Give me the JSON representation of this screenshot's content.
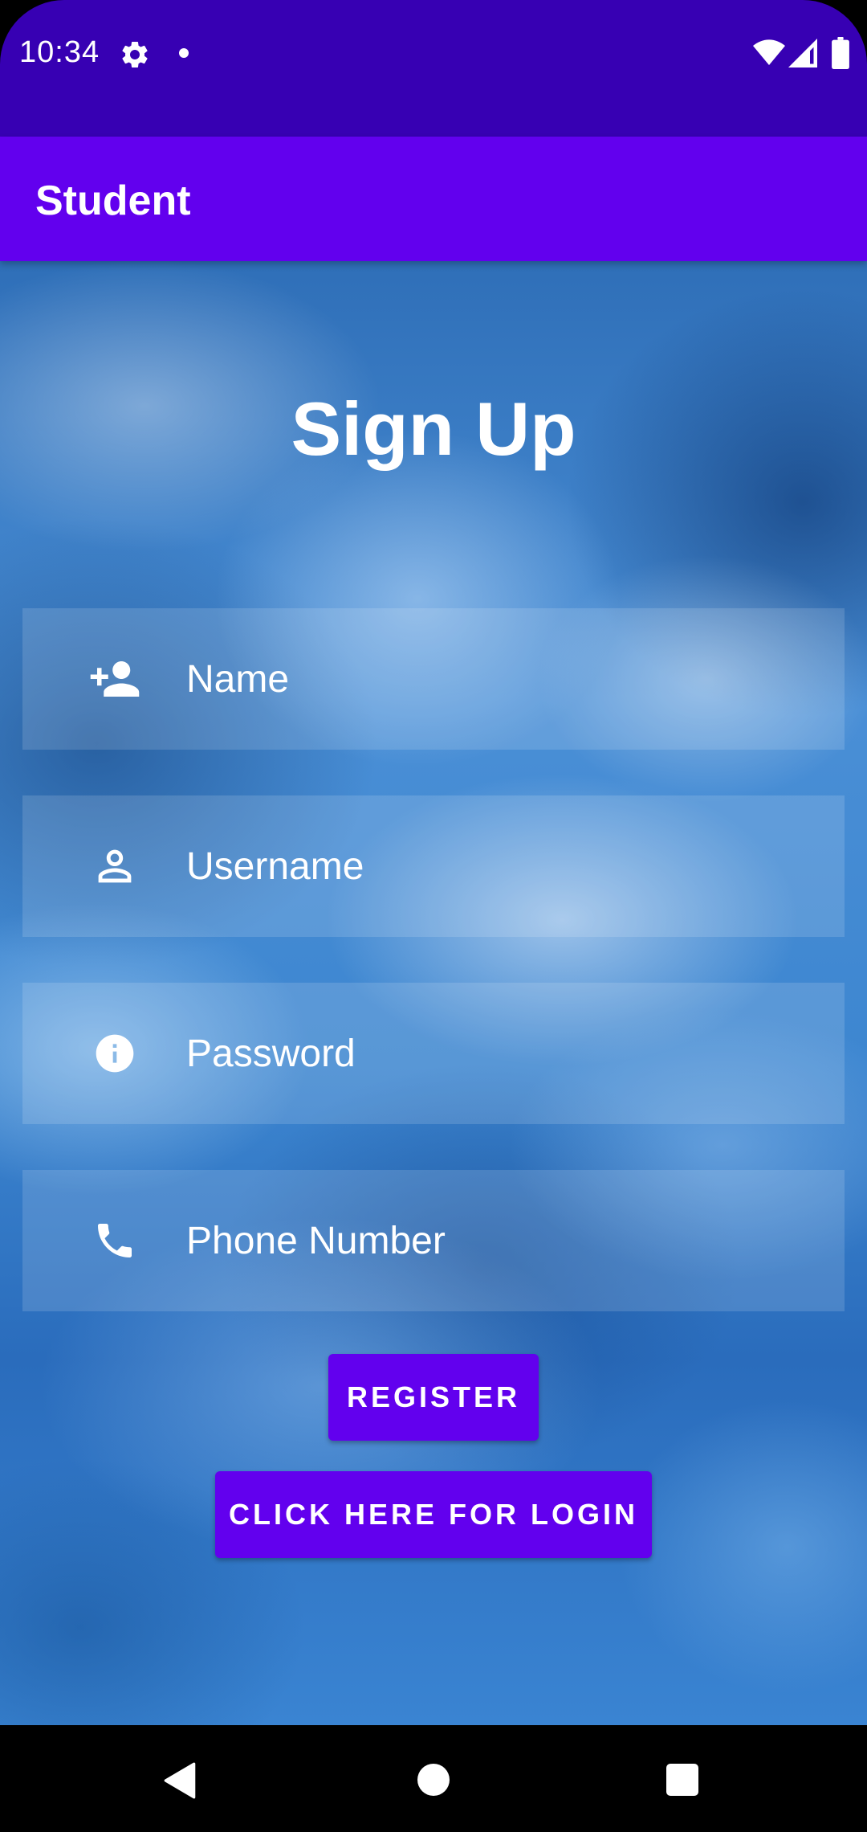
{
  "status_bar": {
    "time": "10:34",
    "icons": [
      "gear-icon",
      "notification-dot",
      "wifi-icon",
      "signal-icon",
      "battery-icon"
    ]
  },
  "app_bar": {
    "title": "Student"
  },
  "form": {
    "heading": "Sign Up",
    "fields": [
      {
        "icon": "person-add-icon",
        "placeholder": "Name",
        "value": ""
      },
      {
        "icon": "person-outline-icon",
        "placeholder": "Username",
        "value": ""
      },
      {
        "icon": "info-icon",
        "placeholder": "Password",
        "value": ""
      },
      {
        "icon": "phone-icon",
        "placeholder": "Phone Number",
        "value": ""
      }
    ],
    "register_label": "REGISTER",
    "login_label": "CLICK HERE FOR LOGIN"
  },
  "nav_bar": {
    "icons": [
      "back-icon",
      "home-icon",
      "recents-icon"
    ]
  },
  "colors": {
    "status_bar": "#3700b3",
    "app_bar": "#6200ee",
    "button": "#6200ee",
    "text": "#ffffff"
  }
}
